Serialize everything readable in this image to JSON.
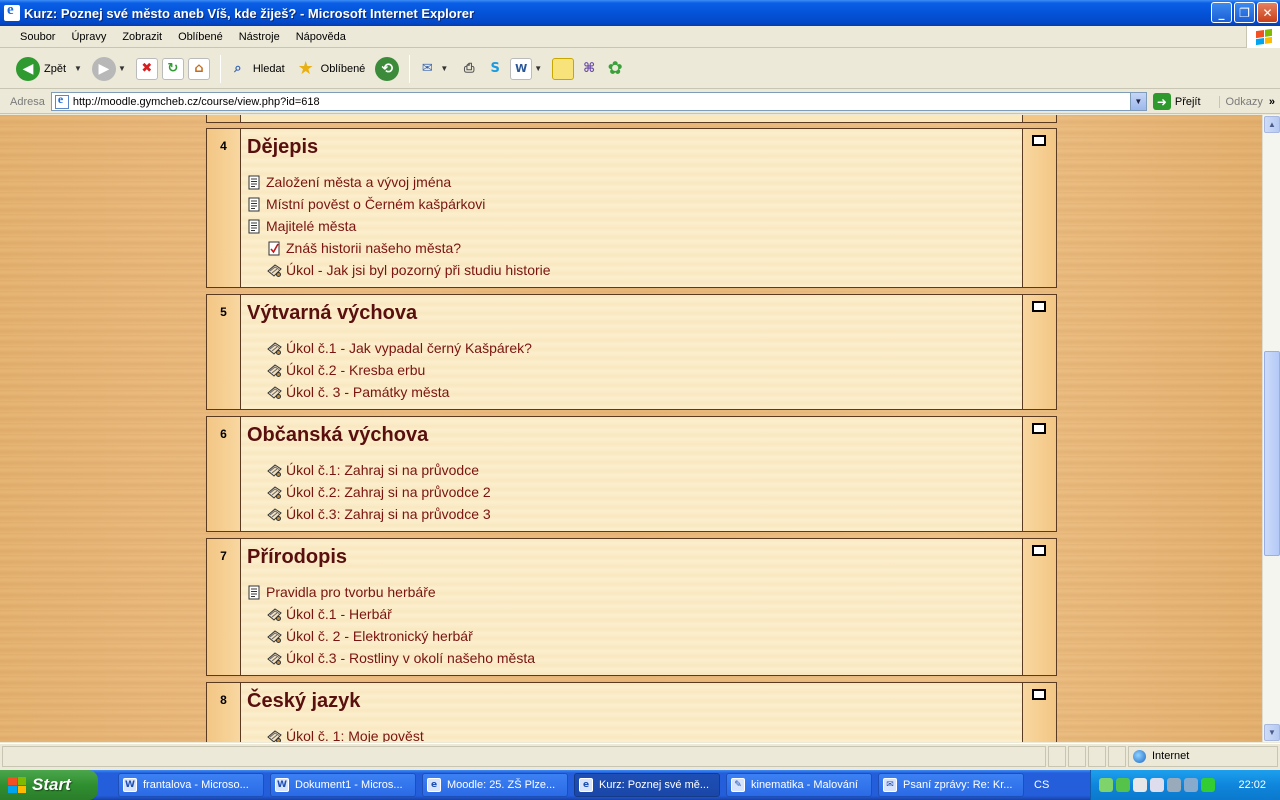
{
  "window": {
    "title": "Kurz: Poznej své město aneb Víš, kde žiješ? - Microsoft Internet Explorer"
  },
  "menu": [
    "Soubor",
    "Úpravy",
    "Zobrazit",
    "Oblíbené",
    "Nástroje",
    "Nápověda"
  ],
  "toolbar": {
    "back": "Zpět",
    "search": "Hledat",
    "favorites": "Oblíbené"
  },
  "address": {
    "label": "Adresa",
    "url": "http://moodle.gymcheb.cz/course/view.php?id=618",
    "go": "Přejít",
    "links": "Odkazy"
  },
  "sections": [
    {
      "num": "4",
      "title": "Dějepis",
      "items": [
        {
          "label": "Založení města a vývoj jména",
          "type": "resource",
          "indent": false
        },
        {
          "label": "Místní pověst o Černém kašpárkovi",
          "type": "resource",
          "indent": false
        },
        {
          "label": "Majitelé města",
          "type": "resource",
          "indent": false
        },
        {
          "label": "Znáš historii našeho města?",
          "type": "quiz",
          "indent": true
        },
        {
          "label": "Úkol - Jak jsi byl pozorný při studiu historie",
          "type": "assignment",
          "indent": true
        }
      ]
    },
    {
      "num": "5",
      "title": "Výtvarná výchova",
      "items": [
        {
          "label": "Úkol č.1 - Jak vypadal černý Kašpárek?",
          "type": "assignment",
          "indent": true
        },
        {
          "label": "Úkol č.2 - Kresba erbu",
          "type": "assignment",
          "indent": true
        },
        {
          "label": "Úkol č. 3 - Památky města",
          "type": "assignment",
          "indent": true
        }
      ]
    },
    {
      "num": "6",
      "title": "Občanská výchova",
      "items": [
        {
          "label": "Úkol č.1: Zahraj si na průvodce",
          "type": "assignment",
          "indent": true
        },
        {
          "label": "Úkol č.2: Zahraj si na průvodce 2",
          "type": "assignment",
          "indent": true
        },
        {
          "label": "Úkol č.3: Zahraj si na průvodce 3",
          "type": "assignment",
          "indent": true
        }
      ]
    },
    {
      "num": "7",
      "title": "Přírodopis",
      "items": [
        {
          "label": "Pravidla pro tvorbu herbáře",
          "type": "resource",
          "indent": false
        },
        {
          "label": "Úkol č.1 - Herbář",
          "type": "assignment",
          "indent": true
        },
        {
          "label": "Úkol č. 2 - Elektronický herbář",
          "type": "assignment",
          "indent": true
        },
        {
          "label": "Úkol č.3 - Rostliny v okolí našeho města",
          "type": "assignment",
          "indent": true
        }
      ]
    },
    {
      "num": "8",
      "title": "Český jazyk",
      "items": [
        {
          "label": "Úkol č. 1: Moje pověst",
          "type": "assignment",
          "indent": true
        }
      ]
    }
  ],
  "status": {
    "zone": "Internet"
  },
  "taskbar": {
    "start": "Start",
    "tasks": [
      {
        "label": "frantalova - Microso...",
        "icon": "W",
        "active": false
      },
      {
        "label": "Dokument1 - Micros...",
        "icon": "W",
        "active": false
      },
      {
        "label": "Moodle: 25. ZŠ Plze...",
        "icon": "e",
        "active": false
      },
      {
        "label": "Kurz: Poznej své mě...",
        "icon": "e",
        "active": true
      },
      {
        "label": "kinematika - Malování",
        "icon": "✎",
        "active": false
      },
      {
        "label": "Psaní zprávy: Re: Kr...",
        "icon": "✉",
        "active": false
      }
    ],
    "lang": "CS",
    "clock": "22:02"
  }
}
